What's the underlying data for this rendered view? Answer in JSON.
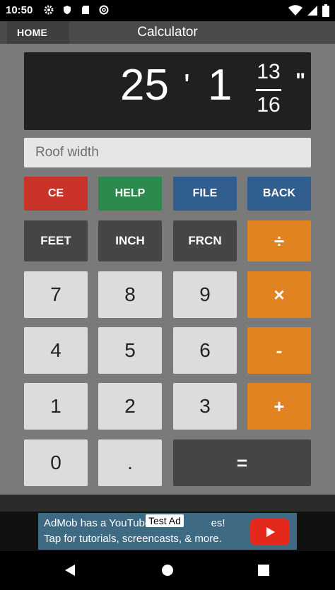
{
  "status": {
    "time": "10:50"
  },
  "appbar": {
    "home_label": "HOME",
    "title": "Calculator"
  },
  "display": {
    "feet": "25",
    "feet_mark": "'",
    "inches": "1",
    "frac_num": "13",
    "frac_den": "16",
    "inch_mark": "\""
  },
  "label_field": {
    "placeholder": "Roof width"
  },
  "buttons": {
    "row1": [
      "CE",
      "HELP",
      "FILE",
      "BACK"
    ],
    "row2": [
      "FEET",
      "INCH",
      "FRCN",
      "÷"
    ],
    "row3": [
      "7",
      "8",
      "9",
      "×"
    ],
    "row4": [
      "4",
      "5",
      "6",
      "-"
    ],
    "row5": [
      "1",
      "2",
      "3",
      "+"
    ],
    "row6": [
      "0",
      ".",
      "="
    ]
  },
  "ad": {
    "line1": "AdMob has a YouTube Ch",
    "line1_end": "es!",
    "line2": "Tap for tutorials, screencasts, & more.",
    "test_label": "Test Ad"
  },
  "colors": {
    "ce": "#c9332a",
    "help": "#2c8a4c",
    "file_back": "#2f5e8f",
    "operator": "#e28321",
    "unit": "#454545",
    "digit": "#dcdcdc",
    "panel": "#7a7a7a"
  }
}
